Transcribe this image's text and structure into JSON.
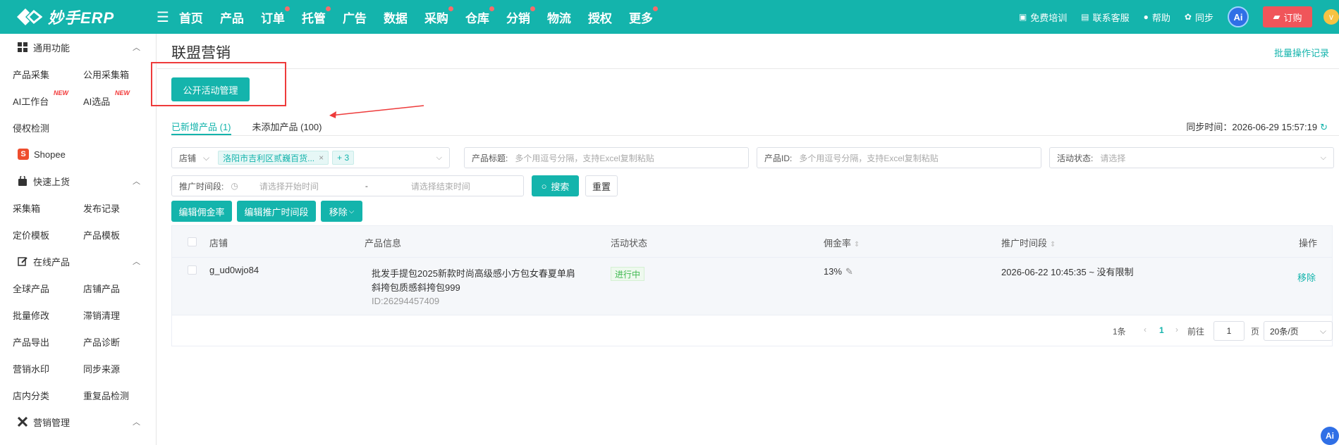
{
  "brand": {
    "name": "妙手ERP"
  },
  "nav": {
    "items": [
      {
        "label": "首页",
        "dot": false
      },
      {
        "label": "产品",
        "dot": false
      },
      {
        "label": "订单",
        "dot": true
      },
      {
        "label": "托管",
        "dot": true
      },
      {
        "label": "广告",
        "dot": false
      },
      {
        "label": "数据",
        "dot": false
      },
      {
        "label": "采购",
        "dot": true
      },
      {
        "label": "仓库",
        "dot": true
      },
      {
        "label": "分销",
        "dot": true
      },
      {
        "label": "物流",
        "dot": false
      },
      {
        "label": "授权",
        "dot": false
      },
      {
        "label": "更多",
        "dot": true
      }
    ]
  },
  "top_right": {
    "training": "免费培训",
    "support": "联系客服",
    "help": "帮助",
    "sync": "同步",
    "ai": "Ai",
    "buy": "订购",
    "avatar": "v"
  },
  "sidebar": {
    "groups": [
      {
        "label": "通用功能",
        "rows": [
          [
            "产品采集",
            "公用采集箱"
          ],
          [
            "AI工作台",
            "AI选品"
          ],
          [
            "侵权检测",
            ""
          ]
        ]
      },
      {
        "label": "快速上货",
        "rows": [
          [
            "采集箱",
            "发布记录"
          ],
          [
            "定价模板",
            "产品模板"
          ]
        ]
      },
      {
        "label": "在线产品",
        "rows": [
          [
            "全球产品",
            "店铺产品"
          ],
          [
            "批量修改",
            "滞销清理"
          ],
          [
            "产品导出",
            "产品诊断"
          ],
          [
            "营销水印",
            "同步来源"
          ],
          [
            "店内分类",
            "重复品检测"
          ]
        ]
      },
      {
        "label": "营销管理",
        "rows": []
      }
    ],
    "new_badge": "NEW",
    "platform": "Shopee",
    "platform_icon": "S"
  },
  "page": {
    "title": "联盟营销",
    "batch_log": "批量操作记录",
    "public_button": "公开活动管理",
    "tabs": [
      {
        "label": "已新增产品 (1)",
        "active": true
      },
      {
        "label": "未添加产品 (100)",
        "active": false
      }
    ],
    "sync_label": "同步时间：2026-06-29 15:57:19",
    "filters": {
      "store_label": "店铺",
      "store_tag": "洛阳市吉利区贰巍百货...",
      "store_more": "+ 3",
      "title_label": "产品标题:",
      "title_placeholder": "多个用逗号分隔，支持Excel复制粘贴",
      "id_label": "产品ID:",
      "id_placeholder": "多个用逗号分隔，支持Excel复制粘贴",
      "status_label": "活动状态:",
      "status_placeholder": "请选择",
      "period_label": "推广时间段:",
      "start_placeholder": "请选择开始时间",
      "range_sep": "-",
      "end_placeholder": "请选择结束时间",
      "search": "搜索",
      "reset": "重置"
    },
    "actions": {
      "edit_commission": "编辑佣金率",
      "edit_period": "编辑推广时间段",
      "remove": "移除"
    },
    "table": {
      "headers": {
        "store": "店铺",
        "product": "产品信息",
        "status": "活动状态",
        "commission": "佣金率",
        "period": "推广时间段",
        "ops": "操作"
      },
      "rows": [
        {
          "store": "g_ud0wjo84",
          "title_line1": "批发手提包2025新款时尚高级感小方包女春夏单肩",
          "title_line2": "斜挎包质感斜挎包999",
          "product_id": "ID:26294457409",
          "status": "进行中",
          "commission": "13%",
          "period": "2026-06-22 10:45:35 ~ 没有限制",
          "op": "移除"
        }
      ]
    },
    "pager": {
      "total": "1条",
      "current": "1",
      "goto_label": "前往",
      "goto_value": "1",
      "page_unit": "页",
      "page_size": "20条/页"
    }
  },
  "colors": {
    "accent": "#14b4ac",
    "danger": "#ee3b3b",
    "status_green": "#3fb950"
  }
}
